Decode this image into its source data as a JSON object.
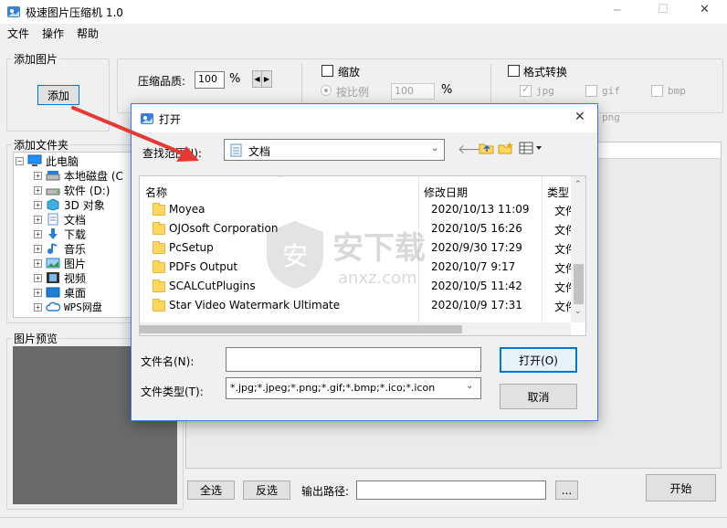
{
  "app": {
    "title": "极速图片压缩机 1.0",
    "window_controls": {
      "minimize": "─",
      "maximize": "☐",
      "close": "✕"
    }
  },
  "menu": [
    "文件",
    "操作",
    "帮助"
  ],
  "add_image": {
    "group_title": "添加图片",
    "add_button": "添加"
  },
  "quality": {
    "label": "压缩品质:",
    "value": "100",
    "unit": "%"
  },
  "scale": {
    "checkbox_label": "缩放",
    "by_ratio_label": "按比例",
    "ratio_value": "100",
    "unit": "%"
  },
  "format": {
    "checkbox_label": "格式转换",
    "options": [
      "jpg",
      "gif",
      "bmp",
      "png"
    ],
    "jpg_checked": true
  },
  "folder_group": {
    "title": "添加文件夹",
    "tree": [
      {
        "label": "此电脑",
        "icon": "computer-icon",
        "level": 0,
        "expander": "−"
      },
      {
        "label": "本地磁盘 (C",
        "icon": "drive-icon",
        "level": 1,
        "expander": "+"
      },
      {
        "label": "软件 (D:)",
        "icon": "drive-icon",
        "level": 1,
        "expander": "+"
      },
      {
        "label": "3D 对象",
        "icon": "3d-objects-icon",
        "level": 1,
        "expander": "+"
      },
      {
        "label": "文档",
        "icon": "documents-icon",
        "level": 1,
        "expander": "+"
      },
      {
        "label": "下载",
        "icon": "download-icon",
        "level": 1,
        "expander": "+"
      },
      {
        "label": "音乐",
        "icon": "music-icon",
        "level": 1,
        "expander": "+"
      },
      {
        "label": "图片",
        "icon": "pictures-icon",
        "level": 1,
        "expander": "+"
      },
      {
        "label": "视频",
        "icon": "video-icon",
        "level": 1,
        "expander": "+"
      },
      {
        "label": "桌面",
        "icon": "desktop-icon",
        "level": 1,
        "expander": "+"
      },
      {
        "label": "WPS网盘",
        "icon": "cloud-icon",
        "level": 1,
        "expander": "+"
      }
    ]
  },
  "preview": {
    "title": "图片预览"
  },
  "bottom": {
    "select_all": "全选",
    "invert": "反选",
    "output_label": "输出路径:",
    "output_value": "",
    "browse": "...",
    "start": "开始"
  },
  "dialog": {
    "title": "打开",
    "look_in_label": "查找范围(I):",
    "look_in_value": "文档",
    "columns": {
      "name": "名称",
      "date": "修改日期",
      "type": "类型"
    },
    "files": [
      {
        "name": "Moyea",
        "date": "2020/10/13 11:09",
        "type": "文件"
      },
      {
        "name": "OJOsoft Corporation",
        "date": "2020/10/5 16:26",
        "type": "文件"
      },
      {
        "name": "PcSetup",
        "date": "2020/9/30 17:29",
        "type": "文件"
      },
      {
        "name": "PDFs Output",
        "date": "2020/10/7 9:17",
        "type": "文件"
      },
      {
        "name": "SCALCutPlugins",
        "date": "2020/10/5 11:42",
        "type": "文件"
      },
      {
        "name": "Star Video Watermark Ultimate",
        "date": "2020/10/9 17:31",
        "type": "文件"
      }
    ],
    "filename_label": "文件名(N):",
    "filename_value": "",
    "filetype_label": "文件类型(T):",
    "filetype_value": "*.jpg;*.jpeg;*.png;*.gif;*.bmp;*.ico;*.icon",
    "open_button": "打开(O)",
    "cancel_button": "取消",
    "close": "✕"
  },
  "watermark": {
    "text": "安下载",
    "subtext": "anxz.com"
  },
  "colors": {
    "accent_blue": "#0078d7",
    "arrow_red": "#e53935",
    "dialog_border": "#3d7ad6",
    "preview_bg": "#6a6a6a"
  }
}
